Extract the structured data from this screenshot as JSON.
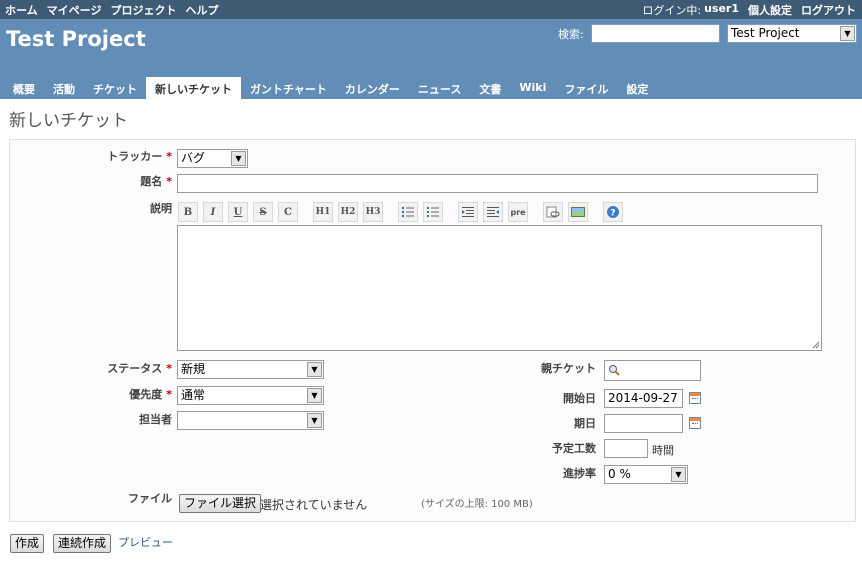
{
  "top_menu": {
    "home": "ホーム",
    "my_page": "マイページ",
    "projects": "プロジェクト",
    "help": "ヘルプ",
    "login_label": "ログイン中:",
    "user": "user1",
    "my_account": "個人設定",
    "logout": "ログアウト"
  },
  "header": {
    "title": "Test Project",
    "search_label": "検索:",
    "search_value": "",
    "project_select": "Test Project"
  },
  "tabs": [
    {
      "label": "概要"
    },
    {
      "label": "活動"
    },
    {
      "label": "チケット"
    },
    {
      "label": "新しいチケット",
      "selected": true
    },
    {
      "label": "ガントチャート"
    },
    {
      "label": "カレンダー"
    },
    {
      "label": "ニュース"
    },
    {
      "label": "文書"
    },
    {
      "label": "Wiki"
    },
    {
      "label": "ファイル"
    },
    {
      "label": "設定"
    }
  ],
  "page_title": "新しいチケット",
  "form": {
    "required_mark": "*",
    "tracker_label": "トラッカー",
    "tracker_value": "バグ",
    "subject_label": "題名",
    "subject_value": "",
    "description_label": "説明",
    "toolbar": [
      "B",
      "I",
      "U",
      "S",
      "C",
      "H1",
      "H2",
      "H3",
      "ul",
      "ol",
      "indent-left",
      "indent-right",
      "pre",
      "link",
      "image",
      "help"
    ],
    "toolbar_labels": {
      "bold": "B",
      "italic": "I",
      "underline": "U",
      "strike": "S",
      "code": "C",
      "h1": "H1",
      "h2": "H2",
      "h3": "H3",
      "pre": "pre"
    },
    "status_label": "ステータス",
    "status_value": "新規",
    "priority_label": "優先度",
    "priority_value": "通常",
    "assignee_label": "担当者",
    "assignee_value": "",
    "parent_label": "親チケット",
    "start_label": "開始日",
    "start_value": "2014-09-27",
    "due_label": "期日",
    "due_value": "",
    "estimated_label": "予定工数",
    "estimated_unit": "時間",
    "done_label": "進捗率",
    "done_value": "0 %",
    "file_label": "ファイル",
    "file_button": "ファイル選択",
    "file_status": "選択されていません",
    "max_size": "(サイズの上限: 100 MB)"
  },
  "actions": {
    "create": "作成",
    "create_continue": "連続作成",
    "preview": "プレビュー"
  },
  "colors": {
    "top_menu_bg": "#3e5b76",
    "header_bg": "#628db6",
    "required": "#bb0000",
    "link": "#2a5685"
  }
}
